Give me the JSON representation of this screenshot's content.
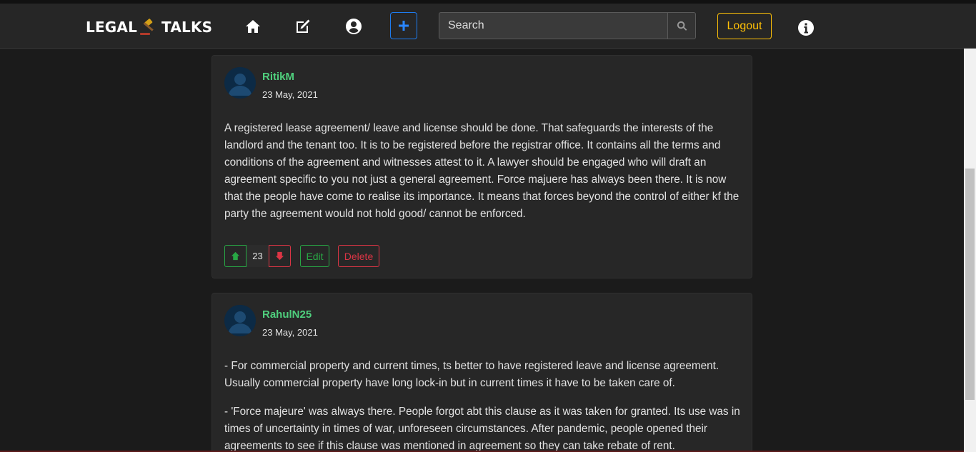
{
  "nav": {
    "brand_left": "LEGAL",
    "brand_right": "TALKS",
    "icons": {
      "home": "home-icon",
      "compose": "edit-icon",
      "profile": "user-circle-icon",
      "add": "plus-icon",
      "search": "search-icon",
      "info": "info-circle-icon"
    },
    "search_placeholder": "Search",
    "logout_label": "Logout"
  },
  "posts": [
    {
      "username": "RitikM",
      "date": "23 May, 2021",
      "paragraphs": [
        "A registered lease agreement/ leave and license should be done. That safeguards the interests of the landlord and the tenant too. It is to be registered before the registrar office. It contains all the terms and conditions of the agreement and witnesses attest to it. A lawyer should be engaged who will draft an agreement specific to you not just a general agreement. Force majuere has always been there. It is now that the people have come to realise its importance. It means that forces beyond the control of either kf the party the agreement would not hold good/ cannot be enforced."
      ],
      "votes": "23",
      "edit_label": "Edit",
      "delete_label": "Delete"
    },
    {
      "username": "RahulN25",
      "date": "23 May, 2021",
      "paragraphs": [
        "- For commercial property and current times, ts better to have registered leave and license agreement. Usually commercial property have long lock-in but in current times it have to be taken care of.",
        "- 'Force majeure' was always there. People forgot abt this clause as it was taken for granted. Its use was in times of uncertainty in times of war, unforeseen circumstances. After pandemic, people opened their agreements to see if this clause was mentioned in agreement so they can take rebate of rent."
      ]
    }
  ],
  "colors": {
    "background": "#1b1b1b",
    "navbar": "#262626",
    "card": "#272727",
    "username": "#4fcf7d",
    "accent_blue": "#1e7cf0",
    "logout_yellow": "#ffc107",
    "success": "#28a745",
    "danger": "#dc3545"
  }
}
